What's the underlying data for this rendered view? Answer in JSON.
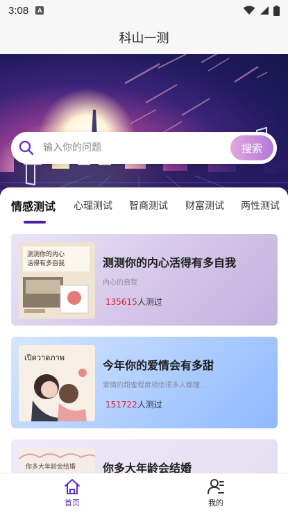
{
  "status_bar": {
    "time": "3:08",
    "notification_icon": "A"
  },
  "header": {
    "title": "科山一测"
  },
  "search": {
    "placeholder": "输入你的问题",
    "button_label": "搜索"
  },
  "tabs": [
    {
      "label": "情感测试",
      "active": true
    },
    {
      "label": "心理测试",
      "active": false
    },
    {
      "label": "智商测试",
      "active": false
    },
    {
      "label": "财富测试",
      "active": false
    },
    {
      "label": "两性测试",
      "active": false
    }
  ],
  "cards": [
    {
      "title": "测测你的内心活得有多自我",
      "description": "内心的自我",
      "count": "135615",
      "count_suffix": "人测过",
      "thumb_icon": "journal-collage-image",
      "thumb_text": "测测你的内心 活得有多自我"
    },
    {
      "title": "今年你的爱情会有多甜",
      "description": "爱情的甜蜜程度相信很多人都懂…",
      "count": "151722",
      "count_suffix": "人测过",
      "thumb_icon": "couple-illustration-image",
      "thumb_text": "เปิดวาดภาพ"
    },
    {
      "title": "你多大年龄会结婚",
      "description": "",
      "count": "",
      "count_suffix": "",
      "thumb_icon": "wedding-age-image",
      "thumb_text": "你多大年龄会结婚"
    }
  ],
  "bottom_nav": [
    {
      "label": "首页",
      "icon": "home-icon",
      "active": true
    },
    {
      "label": "我的",
      "icon": "profile-icon",
      "active": false
    }
  ],
  "colors": {
    "accent": "#5a2bc4",
    "count_red": "#e01e2e",
    "search_button": "#c18fdd"
  }
}
